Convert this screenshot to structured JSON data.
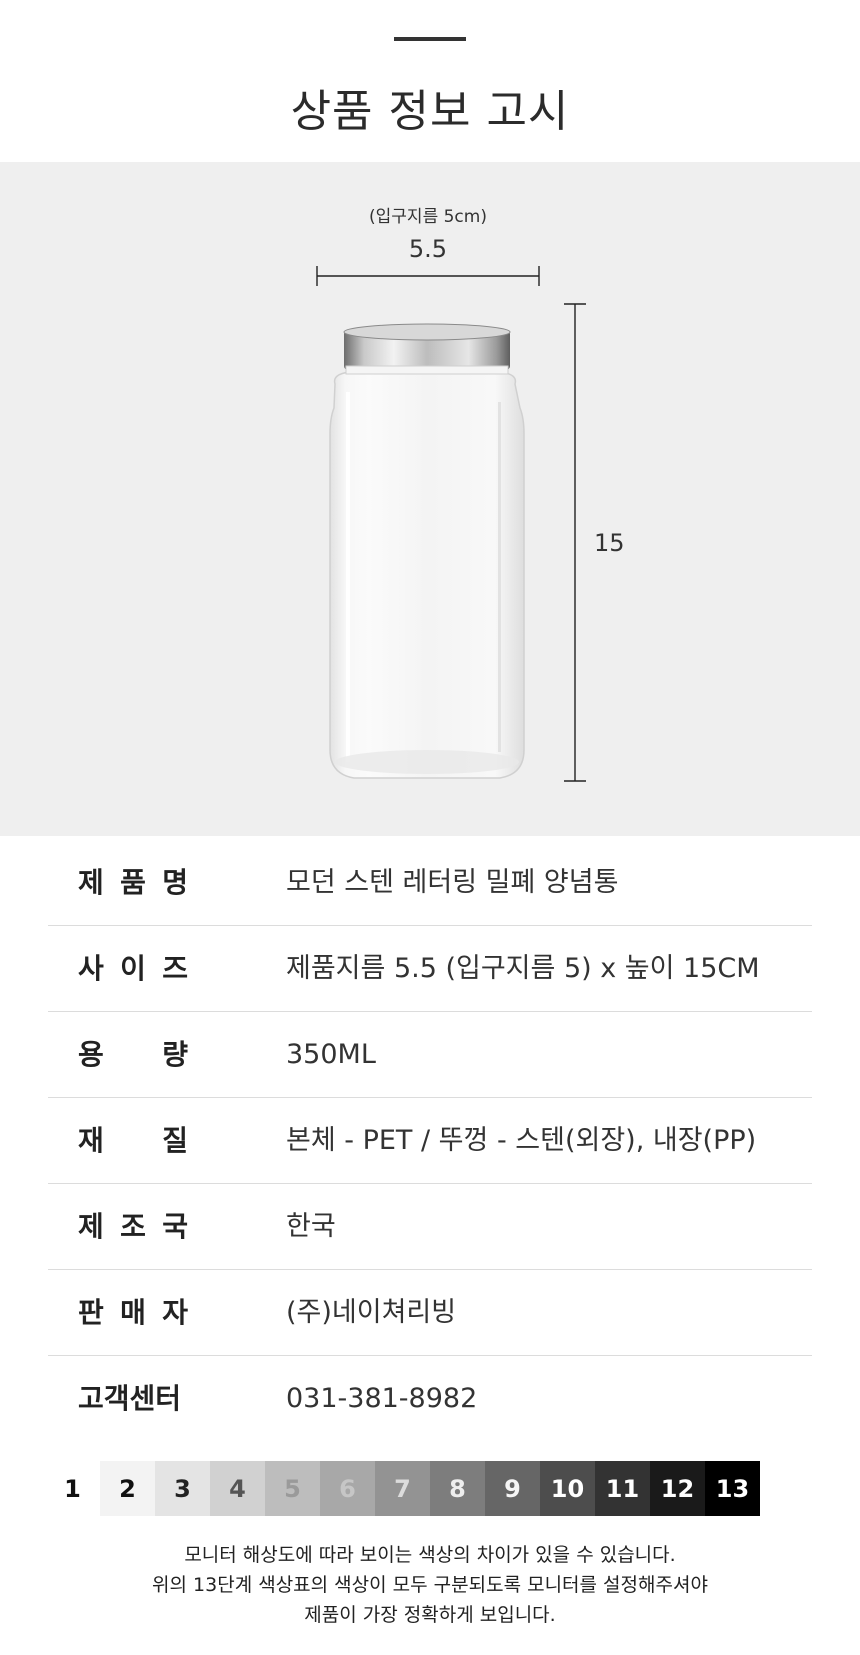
{
  "header": {
    "title": "상품 정보 고시"
  },
  "product_image": {
    "mouth_diameter_label": "(입구지름 5cm)",
    "width_label": "5.5",
    "height_label": "15"
  },
  "specs": [
    {
      "label": "제품명",
      "value": "모던 스텐 레터링 밀폐 양념통"
    },
    {
      "label": "사이즈",
      "value": "제품지름 5.5 (입구지름 5) x 높이 15CM"
    },
    {
      "label": "용량",
      "value": "350ML"
    },
    {
      "label": "재질",
      "value": "본체 - PET  /  뚜껑 - 스텐(외장), 내장(PP)"
    },
    {
      "label": "제조국",
      "value": "한국"
    },
    {
      "label": "판매자",
      "value": "(주)네이쳐리빙"
    },
    {
      "label": "고객센터",
      "value": "031-381-8982"
    }
  ],
  "color_scale": [
    {
      "label": "1",
      "bg": "#ffffff",
      "fg": "#111111"
    },
    {
      "label": "2",
      "bg": "#f3f3f3",
      "fg": "#111111"
    },
    {
      "label": "3",
      "bg": "#e4e4e4",
      "fg": "#222222"
    },
    {
      "label": "4",
      "bg": "#d1d1d1",
      "fg": "#555555"
    },
    {
      "label": "5",
      "bg": "#bdbdbd",
      "fg": "#9a9a9a"
    },
    {
      "label": "6",
      "bg": "#a8a8a8",
      "fg": "#c6c6c6"
    },
    {
      "label": "7",
      "bg": "#939393",
      "fg": "#dcdcdc"
    },
    {
      "label": "8",
      "bg": "#7d7d7d",
      "fg": "#eeeeee"
    },
    {
      "label": "9",
      "bg": "#666666",
      "fg": "#f5f5f5"
    },
    {
      "label": "10",
      "bg": "#4d4d4d",
      "fg": "#ffffff"
    },
    {
      "label": "11",
      "bg": "#333333",
      "fg": "#ffffff"
    },
    {
      "label": "12",
      "bg": "#1a1a1a",
      "fg": "#ffffff"
    },
    {
      "label": "13",
      "bg": "#000000",
      "fg": "#ffffff"
    }
  ],
  "notice": [
    "모니터 해상도에 따라 보이는 색상의 차이가 있을 수 있습니다.",
    "위의 13단계 색상표의 색상이 모두 구분되도록 모니터를 설정해주셔야",
    "제품이 가장 정확하게 보입니다."
  ]
}
